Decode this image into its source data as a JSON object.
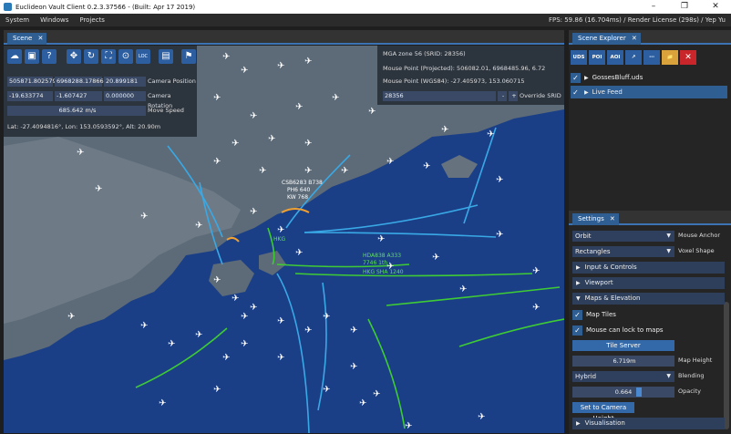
{
  "window": {
    "title": "Euclideon Vault Client 0.2.3.37566 - (Built: Apr 17 2019)",
    "min": "–",
    "max": "❐",
    "close": "✕"
  },
  "menu": {
    "items": [
      "System",
      "Windows",
      "Projects"
    ],
    "status": "FPS: 59.86 (16.704ms) / Render License (298s) / Yep Yu"
  },
  "scene_tab": {
    "label": "Scene",
    "close": "✕"
  },
  "camera": {
    "pos": [
      "505871.802579",
      "6968288.17866",
      "20.899181"
    ],
    "pos_label": "Camera Position",
    "rot": [
      "-19.633774",
      "-1.607427",
      "0.000000"
    ],
    "rot_label": "Camera Rotation",
    "speed": "685.642 m/s",
    "speed_label": "Move Speed",
    "latlon": "Lat: -27.4094816°, Lon: 153.0593592°, Alt: 20.90m"
  },
  "info": {
    "zone": "MGA zone 56 (SRID: 28356)",
    "mouse_proj": "Mouse Point (Projected): 506082.01, 6968485.96, 6.72",
    "mouse_wgs": "Mouse Point (WGS84): -27.405973, 153.060715",
    "srid": "28356",
    "minus": "-",
    "plus": "+",
    "override": "Override SRID"
  },
  "map_labels": {
    "l1": "CSB6283 B738",
    "l2": "PH6 640",
    "l3": "KW 768",
    "l4": "HKG",
    "l5": "HDA838 A333",
    "l6": "7746 1th",
    "l7": "HKG SHA 1240"
  },
  "explorer": {
    "tab": "Scene Explorer",
    "close": "✕",
    "tools": [
      "UDS",
      "POI",
      "AOI",
      "↗",
      "⋯",
      "📁",
      "✕"
    ],
    "items": [
      "GossesBluff.uds",
      "Live Feed"
    ]
  },
  "settings": {
    "tab": "Settings",
    "close": "✕",
    "mouse_anchor_value": "Orbit",
    "mouse_anchor_label": "Mouse Anchor",
    "voxel_value": "Rectangles",
    "voxel_label": "Voxel Shape",
    "sections": [
      "Input & Controls",
      "Viewport",
      "Maps & Elevation"
    ],
    "map_tiles": "Map Tiles",
    "mouse_lock": "Mouse can lock to maps",
    "tile_server": "Tile Server",
    "map_height": "6.719m",
    "map_height_label": "Map Height",
    "blending_value": "Hybrid",
    "blending_label": "Blending",
    "opacity": "0.664",
    "opacity_label": "Opacity",
    "opacity_level": 0.664,
    "set_cam": "Set to Camera Height",
    "visualisation": "Visualisation"
  },
  "colors": {
    "accent": "#2f5e93",
    "sea": "#1b3f87",
    "land": "#5d6b78",
    "plane": "#ffffff",
    "track_blue": "#39a9e6",
    "track_green": "#3ecc34"
  }
}
